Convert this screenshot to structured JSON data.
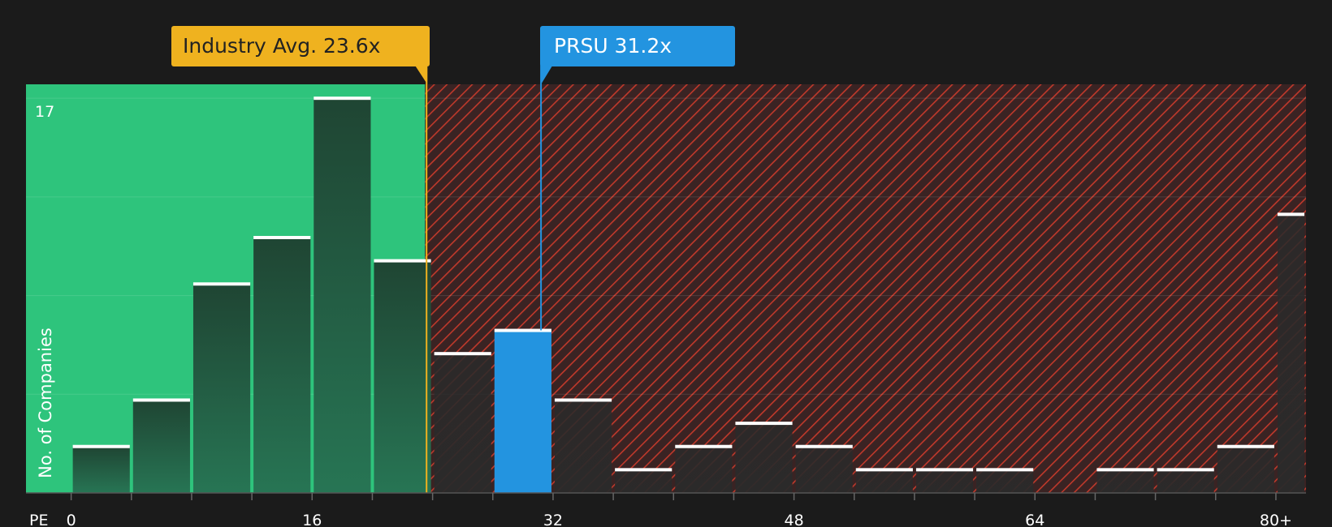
{
  "chart_data": {
    "type": "bar",
    "title": "",
    "xlabel": "PE",
    "ylabel": "No. of Companies",
    "x_ticks": [
      "0",
      "16",
      "32",
      "48",
      "64",
      "80+"
    ],
    "y_ticks": [
      "17"
    ],
    "bin_edges": [
      0,
      4,
      8,
      12,
      16,
      20,
      24,
      28,
      32,
      36,
      40,
      44,
      48,
      52,
      56,
      60,
      64,
      68,
      72,
      76,
      80,
      82
    ],
    "values": [
      2,
      4,
      9,
      11,
      17,
      10,
      6,
      7,
      4,
      1,
      2,
      3,
      2,
      1,
      1,
      1,
      0,
      1,
      1,
      2,
      12
    ],
    "ylim": [
      0,
      17.6
    ],
    "xlim": [
      -3,
      82
    ],
    "highlight_bin": 7,
    "industry_avg": {
      "label": "Industry Avg. 23.6x",
      "value": 23.6
    },
    "company": {
      "label": "PRSU 31.2x",
      "value": 31.2
    },
    "colors": {
      "background": "#1b1b1b",
      "undervalued_zone": "#2ec47c",
      "overvalued_hatch": "#c0392b",
      "industry": "#efb21f",
      "company": "#2394e0",
      "bar_green_top": "#1f4533",
      "bar_green_bottom": "#277554",
      "bar_dark": "#2a2a2a",
      "cap_line": "#ffffff"
    }
  }
}
